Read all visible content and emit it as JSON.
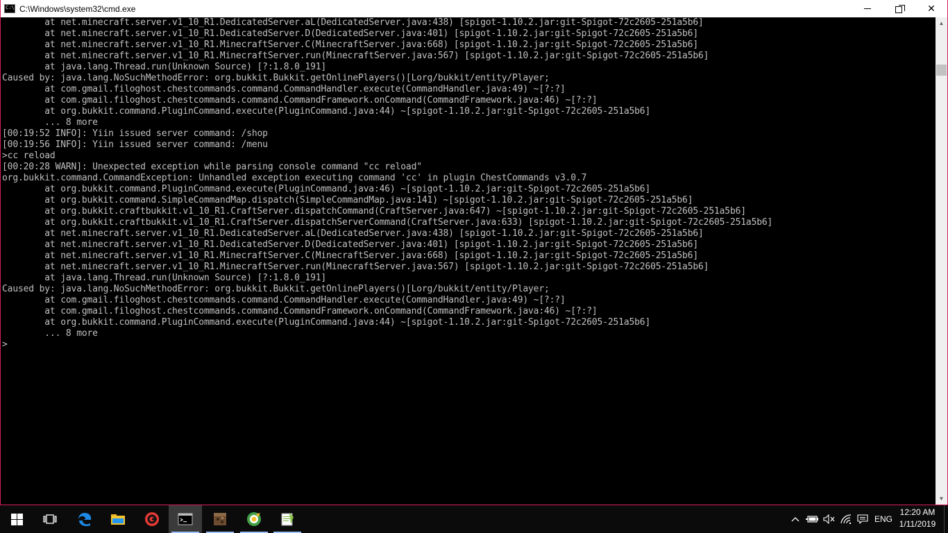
{
  "window": {
    "title": "C:\\Windows\\system32\\cmd.exe",
    "icon_text": "C:\\"
  },
  "console": {
    "lines": [
      "        at net.minecraft.server.v1_10_R1.DedicatedServer.aL(DedicatedServer.java:438) [spigot-1.10.2.jar:git-Spigot-72c2605-251a5b6]",
      "        at net.minecraft.server.v1_10_R1.DedicatedServer.D(DedicatedServer.java:401) [spigot-1.10.2.jar:git-Spigot-72c2605-251a5b6]",
      "        at net.minecraft.server.v1_10_R1.MinecraftServer.C(MinecraftServer.java:668) [spigot-1.10.2.jar:git-Spigot-72c2605-251a5b6]",
      "        at net.minecraft.server.v1_10_R1.MinecraftServer.run(MinecraftServer.java:567) [spigot-1.10.2.jar:git-Spigot-72c2605-251a5b6]",
      "        at java.lang.Thread.run(Unknown Source) [?:1.8.0_191]",
      "Caused by: java.lang.NoSuchMethodError: org.bukkit.Bukkit.getOnlinePlayers()[Lorg/bukkit/entity/Player;",
      "        at com.gmail.filoghost.chestcommands.command.CommandHandler.execute(CommandHandler.java:49) ~[?:?]",
      "        at com.gmail.filoghost.chestcommands.command.CommandFramework.onCommand(CommandFramework.java:46) ~[?:?]",
      "        at org.bukkit.command.PluginCommand.execute(PluginCommand.java:44) ~[spigot-1.10.2.jar:git-Spigot-72c2605-251a5b6]",
      "        ... 8 more",
      "[00:19:52 INFO]: Yiin issued server command: /shop",
      "[00:19:56 INFO]: Yiin issued server command: /menu",
      ">cc reload",
      "[00:20:28 WARN]: Unexpected exception while parsing console command \"cc reload\"",
      "org.bukkit.command.CommandException: Unhandled exception executing command 'cc' in plugin ChestCommands v3.0.7",
      "        at org.bukkit.command.PluginCommand.execute(PluginCommand.java:46) ~[spigot-1.10.2.jar:git-Spigot-72c2605-251a5b6]",
      "        at org.bukkit.command.SimpleCommandMap.dispatch(SimpleCommandMap.java:141) ~[spigot-1.10.2.jar:git-Spigot-72c2605-251a5b6]",
      "        at org.bukkit.craftbukkit.v1_10_R1.CraftServer.dispatchCommand(CraftServer.java:647) ~[spigot-1.10.2.jar:git-Spigot-72c2605-251a5b6]",
      "        at org.bukkit.craftbukkit.v1_10_R1.CraftServer.dispatchServerCommand(CraftServer.java:633) [spigot-1.10.2.jar:git-Spigot-72c2605-251a5b6]",
      "        at net.minecraft.server.v1_10_R1.DedicatedServer.aL(DedicatedServer.java:438) [spigot-1.10.2.jar:git-Spigot-72c2605-251a5b6]",
      "        at net.minecraft.server.v1_10_R1.DedicatedServer.D(DedicatedServer.java:401) [spigot-1.10.2.jar:git-Spigot-72c2605-251a5b6]",
      "        at net.minecraft.server.v1_10_R1.MinecraftServer.C(MinecraftServer.java:668) [spigot-1.10.2.jar:git-Spigot-72c2605-251a5b6]",
      "        at net.minecraft.server.v1_10_R1.MinecraftServer.run(MinecraftServer.java:567) [spigot-1.10.2.jar:git-Spigot-72c2605-251a5b6]",
      "        at java.lang.Thread.run(Unknown Source) [?:1.8.0_191]",
      "Caused by: java.lang.NoSuchMethodError: org.bukkit.Bukkit.getOnlinePlayers()[Lorg/bukkit/entity/Player;",
      "        at com.gmail.filoghost.chestcommands.command.CommandHandler.execute(CommandHandler.java:49) ~[?:?]",
      "        at com.gmail.filoghost.chestcommands.command.CommandFramework.onCommand(CommandFramework.java:46) ~[?:?]",
      "        at org.bukkit.command.PluginCommand.execute(PluginCommand.java:44) ~[spigot-1.10.2.jar:git-Spigot-72c2605-251a5b6]",
      "        ... 8 more"
    ],
    "prompt": ">"
  },
  "taskbar": {
    "language": "ENG",
    "time": "12:20 AM",
    "date": "1/11/2019"
  },
  "colors": {
    "console_bg": "#000000",
    "console_fg": "#c0c0c0",
    "window_border": "#d81b60",
    "taskbar_bg": "#0b0b0b"
  }
}
